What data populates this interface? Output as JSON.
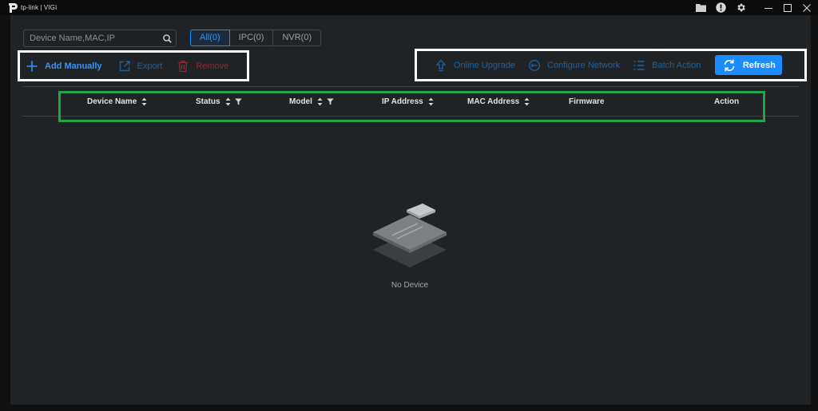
{
  "app": {
    "brand": "tp-link | VIGI"
  },
  "search": {
    "placeholder": "Device Name,MAC,IP",
    "value": ""
  },
  "filters": [
    {
      "label": "All(0)",
      "active": true
    },
    {
      "label": "IPC(0)",
      "active": false
    },
    {
      "label": "NVR(0)",
      "active": false
    }
  ],
  "toolbar_left": {
    "add_manually": "Add Manually",
    "export": "Export",
    "remove": "Remove"
  },
  "toolbar_right": {
    "online_upgrade": "Online Upgrade",
    "configure_network": "Configure Network",
    "batch_action": "Batch Action",
    "refresh": "Refresh"
  },
  "table": {
    "columns": [
      {
        "label": "Device Name",
        "sortable": true,
        "filterable": false
      },
      {
        "label": "Status",
        "sortable": true,
        "filterable": true
      },
      {
        "label": "Model",
        "sortable": true,
        "filterable": true
      },
      {
        "label": "IP Address",
        "sortable": true,
        "filterable": false
      },
      {
        "label": "MAC Address",
        "sortable": true,
        "filterable": false
      },
      {
        "label": "Firmware",
        "sortable": false,
        "filterable": false
      },
      {
        "label": "Action",
        "sortable": false,
        "filterable": false
      }
    ],
    "rows": []
  },
  "empty_state": {
    "text": "No Device"
  },
  "colors": {
    "accent": "#1a8cff",
    "background": "#202326",
    "highlight_white": "#ffffff",
    "highlight_green": "#23a34a",
    "remove": "#8a2a34"
  }
}
